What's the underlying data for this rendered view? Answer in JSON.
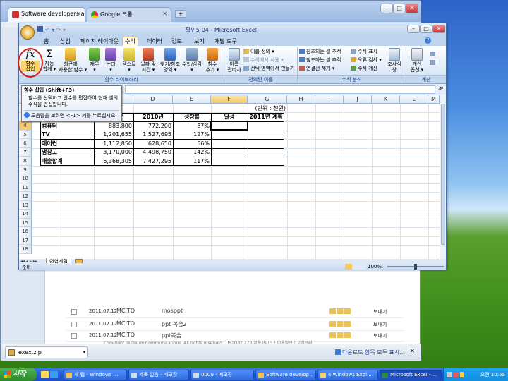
{
  "browser": {
    "tab1": "Software developers and",
    "tab2": "Google 크롬",
    "web_rows": [
      {
        "date": "2011.07.12",
        "user": "MCITO",
        "title": "mosppt",
        "action": "보내기"
      },
      {
        "date": "2011.07.12",
        "user": "MCITO",
        "title": "ppt 복습2",
        "action": "보내기"
      },
      {
        "date": "2011.07.12",
        "user": "MCITO",
        "title": "ppt복습",
        "action": "보내기"
      }
    ],
    "footer": "Copyright @ Daum Communications. All rights reserved. TISTORY 170   이용가이드 | 이용약관 | 고객센터",
    "download_file": "exex.zip",
    "download_all": "다운로드 항목 모두 표시..."
  },
  "excel": {
    "title": "확인5-04 - Microsoft Excel",
    "tabs": [
      "홈",
      "삽입",
      "페이지 레이아웃",
      "수식",
      "데이터",
      "검토",
      "보기",
      "개발 도구"
    ],
    "active_tab": "수식",
    "ribbon": {
      "insert_function": "함수\n삽입",
      "autosum": "자동\n합계 ▾",
      "recent": "최근에\n사용한 함수 ▾",
      "financial": "재무\n▾",
      "logical": "논리\n▾",
      "text": "텍스트\n▾",
      "datetime": "날짜 및\n시간 ▾",
      "lookup": "찾기/참조\n영역 ▾",
      "math": "수학/삼각\n▾",
      "more": "함수\n추가 ▾",
      "group_library": "함수 라이브러리",
      "name_manager": "이름\n관리자",
      "define_name": "이름 정의 ▾",
      "use_in_formula": "수식에서 사용 ▾",
      "create_from_selection": "선택 영역에서 만들기",
      "group_names": "정의된 이름",
      "trace_precedents": "참조되는 셀 추적",
      "trace_dependents": "참조하는 셀 추적",
      "remove_arrows": "연결선 제거 ▾",
      "show_formulas": "수식 표시",
      "error_check": "오류 검사 ▾",
      "evaluate": "수식 계산",
      "watch": "조사식\n창",
      "group_audit": "수식 분석",
      "calc_options": "계산\n옵션 ▾",
      "group_calc": "계산"
    },
    "tooltip": {
      "title": "함수 삽입 (Shift+F3)",
      "body": "함수를 선택하고 인수를 편집하여 현재 셀의 수식을 편집합니다.",
      "help": "도움말을 보려면 <F1> 키를 누르십시오."
    },
    "columns": [
      "D",
      "E",
      "F",
      "G",
      "H",
      "I",
      "J",
      "K",
      "L",
      "M"
    ],
    "selected_col": "F",
    "rows": [
      "3",
      "4",
      "5",
      "6",
      "7",
      "8",
      "9",
      "10",
      "11",
      "12",
      "13",
      "14",
      "15",
      "16",
      "17",
      "18"
    ],
    "selected_row": "4",
    "unit_note": "(단위 : 천원)",
    "headers": [
      "품명",
      "2009년",
      "2010년",
      "성장률",
      "달성",
      "2011년 계획"
    ],
    "table": [
      {
        "name": "컴퓨터",
        "y2009": "883,800",
        "y2010": "772,200",
        "rate": "87%"
      },
      {
        "name": "TV",
        "y2009": "1,201,655",
        "y2010": "1,527,695",
        "rate": "127%"
      },
      {
        "name": "에어컨",
        "y2009": "1,112,850",
        "y2010": "628,650",
        "rate": "56%"
      },
      {
        "name": "냉장고",
        "y2009": "3,170,000",
        "y2010": "4,498,750",
        "rate": "142%"
      },
      {
        "name": "매출합계",
        "y2009": "6,368,305",
        "y2010": "7,427,295",
        "rate": "117%"
      }
    ],
    "sheet_tab": "영업계획",
    "status": "준비",
    "zoom": "100%"
  },
  "taskbar": {
    "start": "시작",
    "items": [
      "새 탭 - Windows ...",
      "제목 없음 - 메모장",
      "0000 - 메모장",
      "Software develop...",
      "4 Windows Expl...",
      "Microsoft Excel - ..."
    ],
    "active_index": 5,
    "clock": "오전 10:55"
  }
}
